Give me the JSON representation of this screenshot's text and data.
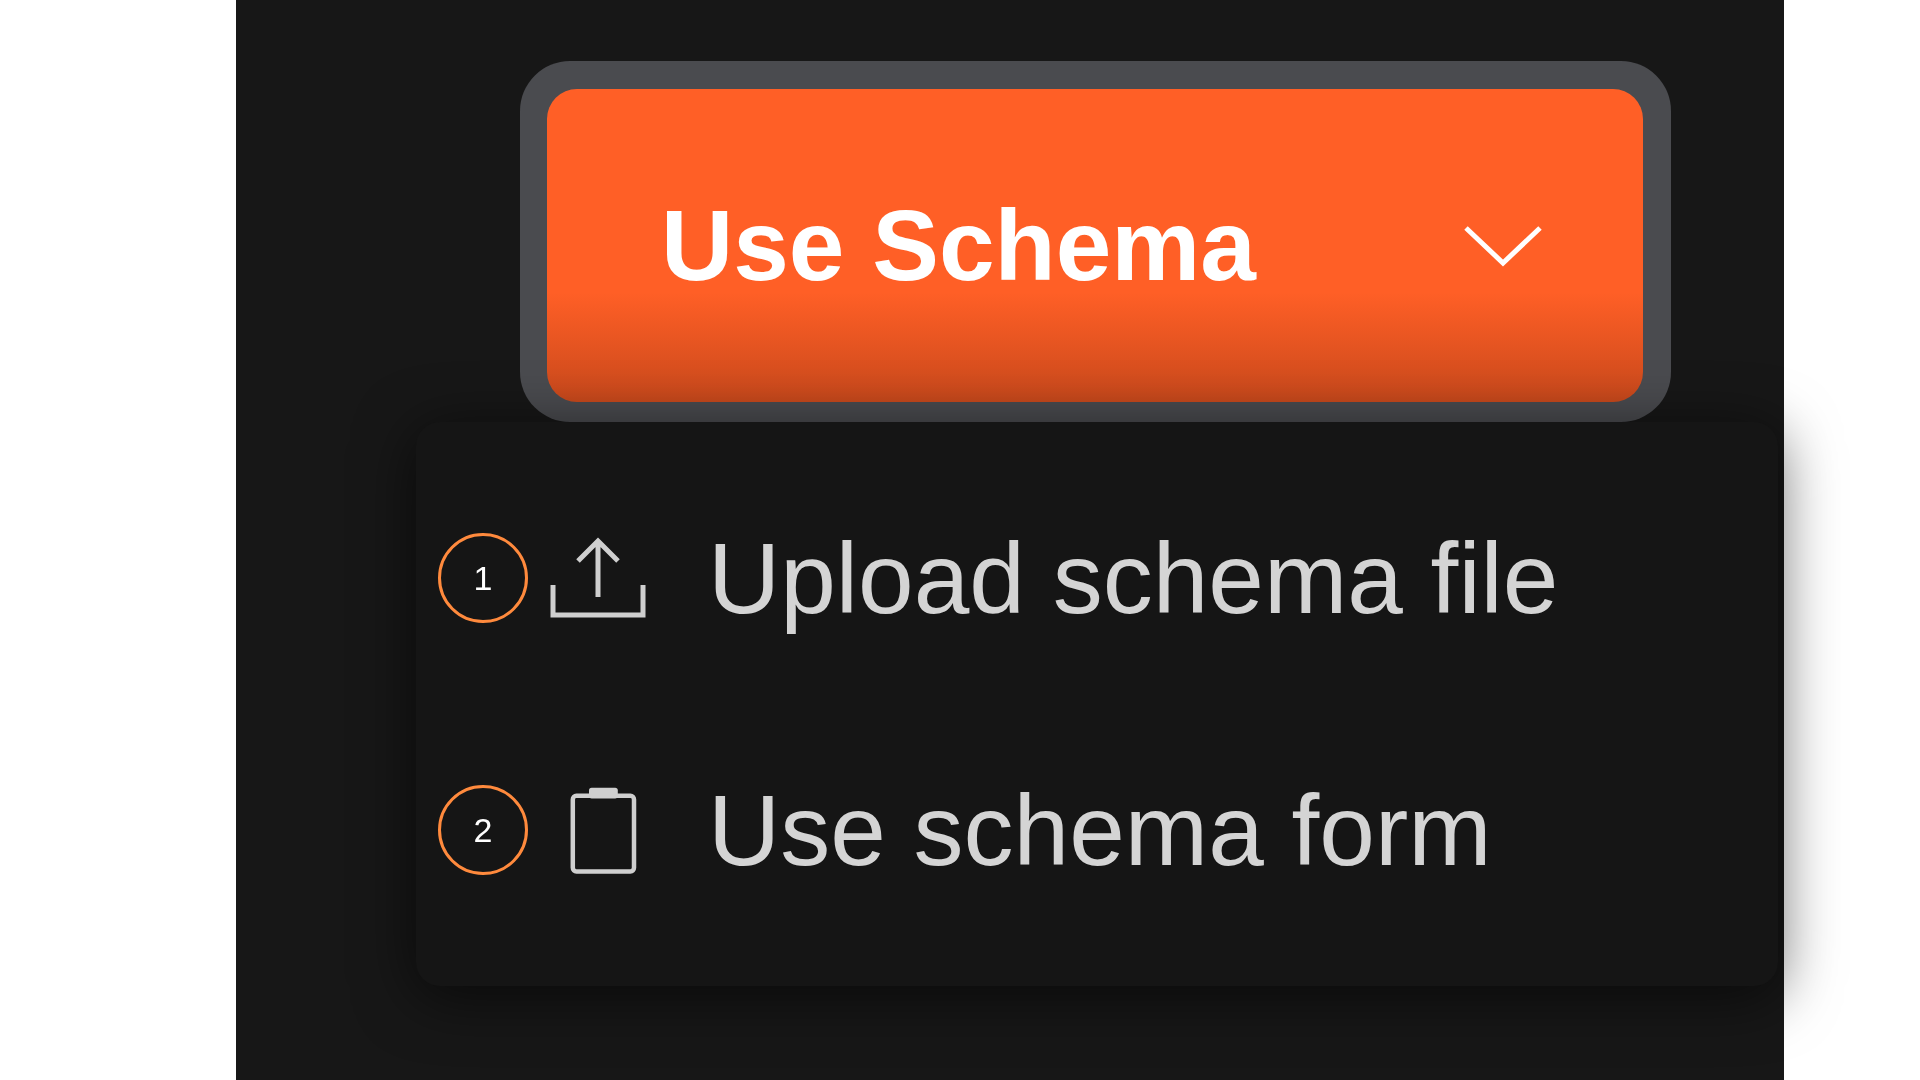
{
  "button": {
    "label": "Use Schema"
  },
  "menu": {
    "items": [
      {
        "badge": "1",
        "kind": "upload",
        "label": "Upload schema file"
      },
      {
        "badge": "2",
        "kind": "clipboard",
        "label": "Use schema form"
      }
    ]
  }
}
